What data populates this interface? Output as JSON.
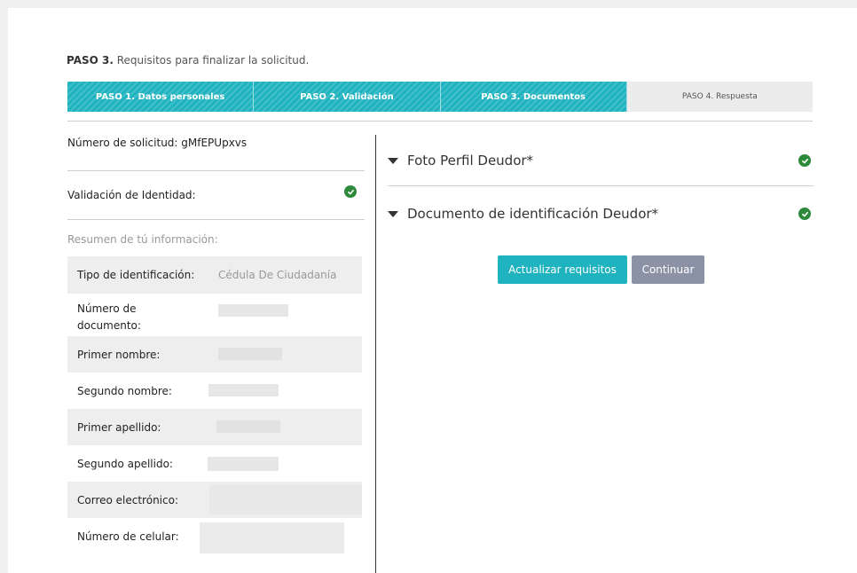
{
  "header": {
    "step_bold": "PASO 3.",
    "step_text": "Requisitos para finalizar la solicitud."
  },
  "stepper": {
    "steps": [
      {
        "label": "PASO 1. Datos personales",
        "state": "complete"
      },
      {
        "label": "PASO 2. Validación",
        "state": "complete"
      },
      {
        "label": "PASO 3. Documentos",
        "state": "current"
      },
      {
        "label": "PASO 4. Respuesta",
        "state": "pending"
      }
    ],
    "color_active": "#1fb3bf",
    "color_pending": "#ececec"
  },
  "left": {
    "request_number": "Número de solicitud: gMfEPUpxvs",
    "identity_validation": "Validación de Identidad:",
    "identity_status_icon": "check-circle-icon",
    "summary_heading": "Resumen de tú información:",
    "rows": [
      {
        "label": "Tipo de identificación:",
        "value": "Cédula De Ciudadanía"
      },
      {
        "label": "Número de documento:",
        "value": ""
      },
      {
        "label": "Primer nombre:",
        "value": ""
      },
      {
        "label": "Segundo nombre:",
        "value": ""
      },
      {
        "label": "Primer apellido:",
        "value": ""
      },
      {
        "label": "Segundo apellido:",
        "value": ""
      },
      {
        "label": "Correo electrónico:",
        "value": ""
      },
      {
        "label": "Número de celular:",
        "value": ""
      }
    ]
  },
  "right": {
    "requirements": [
      {
        "title": "Foto Perfil Deudor*",
        "status_icon": "check-circle-icon"
      },
      {
        "title": "Documento de identificación Deudor*",
        "status_icon": "check-circle-icon"
      }
    ],
    "update_button": "Actualizar requisitos",
    "continue_button": "Continuar"
  },
  "colors": {
    "success": "#2d8a3a",
    "accent": "#1fb3bf",
    "secondary_button": "#8c92a6"
  }
}
